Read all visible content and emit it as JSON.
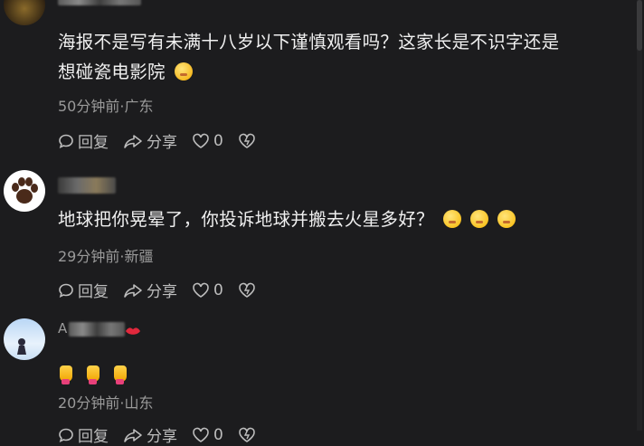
{
  "comments": [
    {
      "text_line1": "海报不是写有未满十八岁以下谨慎观看吗？这家长是不识字还是",
      "text_line2": "想碰瓷电影院",
      "meta": "50分钟前·广东",
      "reply_label": "回复",
      "share_label": "分享",
      "like_count": "0"
    },
    {
      "text": "地球把你晃晕了，你投诉地球并搬去火星多好？",
      "meta": "29分钟前·新疆",
      "reply_label": "回复",
      "share_label": "分享",
      "like_count": "0"
    },
    {
      "name_visible": "A",
      "meta": "20分钟前·山东",
      "reply_label": "回复",
      "share_label": "分享",
      "like_count": "0"
    }
  ],
  "icons": {
    "reply": "comment-bubble-icon",
    "share": "share-arrow-icon",
    "like": "heart-icon",
    "dislike": "broken-heart-icon"
  },
  "colors": {
    "background": "#1c1c1e",
    "text": "#f0f0f0",
    "meta": "#9a9a9a"
  }
}
